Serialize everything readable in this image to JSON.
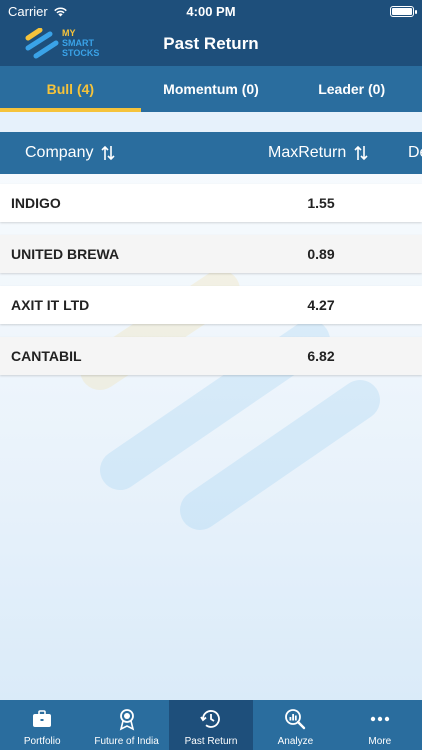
{
  "status": {
    "carrier": "Carrier",
    "time": "4:00 PM"
  },
  "header": {
    "title": "Past Return",
    "logo_line1": "MY",
    "logo_line2": "SMART",
    "logo_line3": "STOCKS"
  },
  "tabs": [
    {
      "label": "Bull (4)"
    },
    {
      "label": "Momentum (0)"
    },
    {
      "label": "Leader (0)"
    }
  ],
  "table": {
    "columns": [
      "Company",
      "MaxReturn",
      "De"
    ],
    "rows": [
      {
        "company": "INDIGO",
        "max_return": "1.55"
      },
      {
        "company": "UNITED BREWA",
        "max_return": "0.89"
      },
      {
        "company": "AXIT IT LTD",
        "max_return": "4.27"
      },
      {
        "company": "CANTABIL",
        "max_return": "6.82"
      }
    ]
  },
  "tabbar": {
    "items": [
      {
        "label": "Portfolio",
        "icon": "briefcase-icon"
      },
      {
        "label": "Future of India",
        "icon": "award-icon"
      },
      {
        "label": "Past Return",
        "icon": "clock-history-icon"
      },
      {
        "label": "Analyze",
        "icon": "magnifier-chart-icon"
      },
      {
        "label": "More",
        "icon": "more-dots-icon"
      }
    ]
  },
  "colors": {
    "primary": "#2a6d9e",
    "dark": "#1e4f7b",
    "accent": "#f5c33b"
  }
}
